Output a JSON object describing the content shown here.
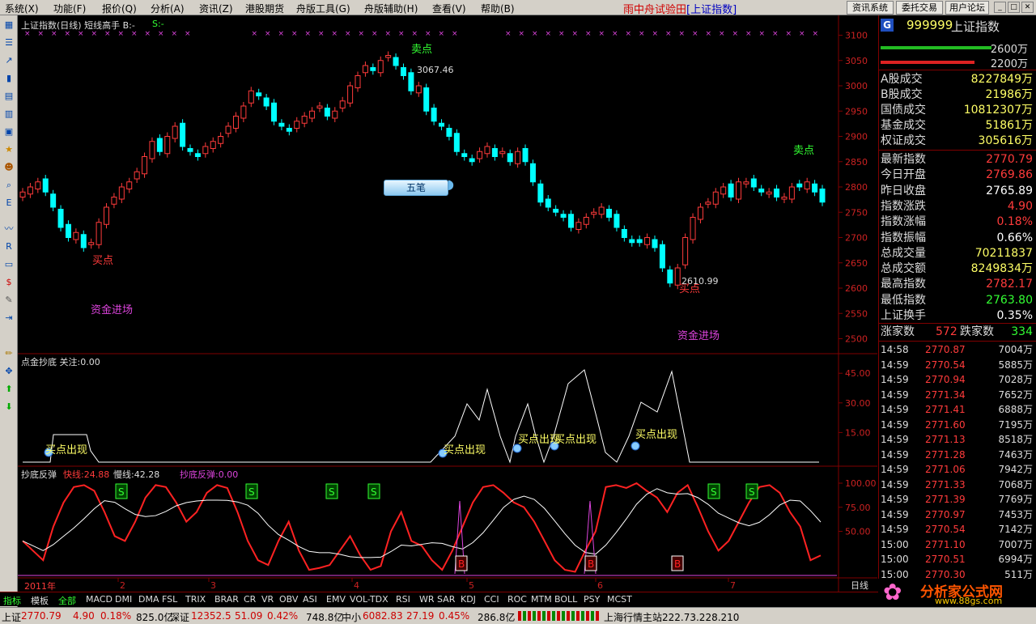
{
  "menubar": {
    "items": [
      "系统(X)",
      "功能(F)",
      "报价(Q)",
      "分析(A)",
      "资讯(Z)",
      "港股期货",
      "舟版工具(G)",
      "舟版辅助(H)",
      "查看(V)",
      "帮助(B)"
    ],
    "title": "雨中舟试验田",
    "title_bracket": "[上证指数]",
    "buttons": [
      "资讯系统",
      "委托交易",
      "用户论坛"
    ],
    "win_controls": [
      "_",
      "□",
      "✕"
    ]
  },
  "chart": {
    "header": "上证指数(日线) 短线高手  B:-",
    "header_s": "S:-",
    "sell_label": "卖点",
    "sell_label2": "卖点",
    "buy_label": "买点",
    "buy_label2": "买点",
    "high_price": "3067.46",
    "low_price": "2610.99",
    "fund_in": "资金进场",
    "fund_in2": "资金进场",
    "bubble": "五笔",
    "price_ticks": [
      "3100",
      "3050",
      "3000",
      "2950",
      "2900",
      "2850",
      "2800",
      "2750",
      "2700",
      "2650",
      "2600",
      "2550",
      "2500"
    ],
    "colors": {
      "up": "#ff3b3b",
      "down": "#00ffff",
      "axis": "#800000"
    }
  },
  "panel2": {
    "header": "点金抄底 关注:0.00",
    "ticks": [
      "45.00",
      "30.00",
      "15.00"
    ],
    "signals": [
      "买点出现",
      "买点出现",
      "买点出现",
      "买点出现",
      "买点出现"
    ]
  },
  "panel3": {
    "header": "抄底反弹",
    "fast": "快线:24.88",
    "slow": "慢线:42.28",
    "rebound": "抄底反弹:0.00",
    "ticks": [
      "100.00",
      "75.00",
      "50.00"
    ],
    "s_marks": [
      "S",
      "S",
      "S",
      "S",
      "S",
      "S"
    ],
    "b_marks": [
      "B",
      "B",
      "B",
      "B"
    ]
  },
  "xaxis": {
    "year": "2011年",
    "months": [
      "2",
      "3",
      "4",
      "5",
      "6",
      "7"
    ],
    "period": "日线"
  },
  "chart_data": {
    "type": "candlestick",
    "symbol": "上证指数",
    "ylim": [
      2480,
      3120
    ],
    "high_marker": 3067.46,
    "low_marker": 2610.99,
    "closes": [
      2790,
      2800,
      2810,
      2790,
      2760,
      2720,
      2700,
      2710,
      2680,
      2690,
      2730,
      2760,
      2780,
      2800,
      2810,
      2830,
      2860,
      2890,
      2870,
      2900,
      2920,
      2880,
      2870,
      2860,
      2880,
      2890,
      2900,
      2920,
      2940,
      2960,
      2990,
      2980,
      2960,
      2930,
      2920,
      2910,
      2930,
      2940,
      2950,
      2960,
      2940,
      2950,
      2970,
      3000,
      3020,
      3040,
      3030,
      3050,
      3060,
      3040,
      3020,
      2990,
      3000,
      2950,
      2930,
      2920,
      2900,
      2870,
      2860,
      2850,
      2870,
      2880,
      2860,
      2870,
      2850,
      2870,
      2850,
      2810,
      2770,
      2760,
      2750,
      2740,
      2720,
      2730,
      2740,
      2750,
      2760,
      2740,
      2720,
      2700,
      2690,
      2690,
      2700,
      2680,
      2640,
      2610,
      2640,
      2700,
      2740,
      2760,
      2770,
      2790,
      2800,
      2780,
      2810,
      2810,
      2800,
      2790,
      2790,
      2780,
      2780,
      2800,
      2800,
      2810,
      2790,
      2770
    ]
  },
  "quote": {
    "badge": "G",
    "code": "999999",
    "name": "上证指数",
    "bar_green_val": "2600万",
    "bar_red_val": "2200万",
    "rows1": [
      {
        "label": "A股成交",
        "value": "8227849万"
      },
      {
        "label": "B股成交",
        "value": "21986万"
      },
      {
        "label": "国债成交",
        "value": "10812307万"
      },
      {
        "label": "基金成交",
        "value": "51861万"
      },
      {
        "label": "权证成交",
        "value": "305616万"
      }
    ],
    "rows2": [
      {
        "label": "最新指数",
        "value": "2770.79",
        "color": "#ff3b3b"
      },
      {
        "label": "今日开盘",
        "value": "2769.86",
        "color": "#ff3b3b"
      },
      {
        "label": "昨日收盘",
        "value": "2765.89",
        "color": "#ffffff"
      },
      {
        "label": "指数涨跌",
        "value": "4.90",
        "color": "#ff3b3b"
      },
      {
        "label": "指数涨幅",
        "value": "0.18%",
        "color": "#ff3b3b"
      },
      {
        "label": "指数振幅",
        "value": "0.66%",
        "color": "#ffffff"
      },
      {
        "label": "总成交量",
        "value": "70211837",
        "color": "#ffff66"
      },
      {
        "label": "总成交额",
        "value": "8249834万",
        "color": "#ffff66"
      },
      {
        "label": "最高指数",
        "value": "2782.17",
        "color": "#ff3b3b"
      },
      {
        "label": "最低指数",
        "value": "2763.80",
        "color": "#33ff33"
      },
      {
        "label": "上证换手",
        "value": "0.35%",
        "color": "#ffffff"
      }
    ],
    "up_label": "涨家数",
    "up_count": "572",
    "down_label": "跌家数",
    "down_count": "334",
    "ticks": [
      {
        "time": "14:58",
        "price": "2770.87",
        "vol": "7004万"
      },
      {
        "time": "14:59",
        "price": "2770.54",
        "vol": "5885万"
      },
      {
        "time": "14:59",
        "price": "2770.94",
        "vol": "7028万"
      },
      {
        "time": "14:59",
        "price": "2771.34",
        "vol": "7652万"
      },
      {
        "time": "14:59",
        "price": "2771.41",
        "vol": "6888万"
      },
      {
        "time": "14:59",
        "price": "2771.60",
        "vol": "7195万"
      },
      {
        "time": "14:59",
        "price": "2771.13",
        "vol": "8518万"
      },
      {
        "time": "14:59",
        "price": "2771.28",
        "vol": "7463万"
      },
      {
        "time": "14:59",
        "price": "2771.06",
        "vol": "7942万"
      },
      {
        "time": "14:59",
        "price": "2771.33",
        "vol": "7068万"
      },
      {
        "time": "14:59",
        "price": "2771.39",
        "vol": "7769万"
      },
      {
        "time": "14:59",
        "price": "2770.97",
        "vol": "7453万"
      },
      {
        "time": "14:59",
        "price": "2770.54",
        "vol": "7142万"
      },
      {
        "time": "15:00",
        "price": "2771.10",
        "vol": "7007万"
      },
      {
        "time": "15:00",
        "price": "2770.51",
        "vol": "6994万"
      },
      {
        "time": "15:00",
        "price": "2770.30",
        "vol": "511万"
      }
    ],
    "logo": "分析家公式网",
    "logo_url": "www.88gs.com"
  },
  "tabs": [
    "指标",
    "模板",
    "全部",
    "MACD",
    "DMI",
    "DMA",
    "FSL",
    "TRIX",
    "BRAR",
    "CR",
    "VR",
    "OBV",
    "ASI",
    "EMV",
    "VOL-TDX",
    "RSI",
    "WR",
    "SAR",
    "KDJ",
    "CCI",
    "ROC",
    "MTM",
    "BOLL",
    "PSY",
    "MCST"
  ],
  "status": {
    "sh_label": "上证",
    "sh_val": "2770.79",
    "sh_chg": "4.90",
    "sh_pct": "0.18%",
    "sh_amt": "825.0亿",
    "sz_label": "深证",
    "sz_val": "12352.5",
    "sz_chg": "51.09",
    "sz_pct": "0.42%",
    "sz_amt": "748.8亿",
    "zx_label": "中小",
    "zx_val": "6082.83",
    "zx_chg": "27.19",
    "zx_pct": "0.45%",
    "zx_amt": "286.8亿",
    "server": "上海行情主站222.73.228.210"
  }
}
